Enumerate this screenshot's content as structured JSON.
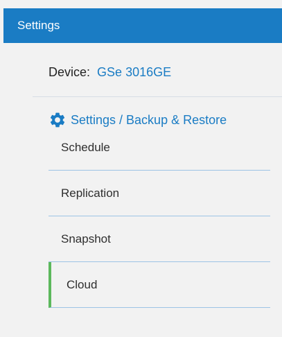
{
  "header": {
    "title": "Settings"
  },
  "device": {
    "label": "Device:",
    "name": "GSe 3016GE"
  },
  "section": {
    "icon": "gear-icon",
    "title": "Settings / Backup & Restore"
  },
  "menu": {
    "items": [
      {
        "label": "Schedule"
      },
      {
        "label": "Replication"
      },
      {
        "label": "Snapshot"
      },
      {
        "label": "Cloud",
        "active": true
      }
    ]
  },
  "colors": {
    "accent": "#1a7cc4",
    "active_indicator": "#5cb85c",
    "background": "#f2f2f2"
  }
}
